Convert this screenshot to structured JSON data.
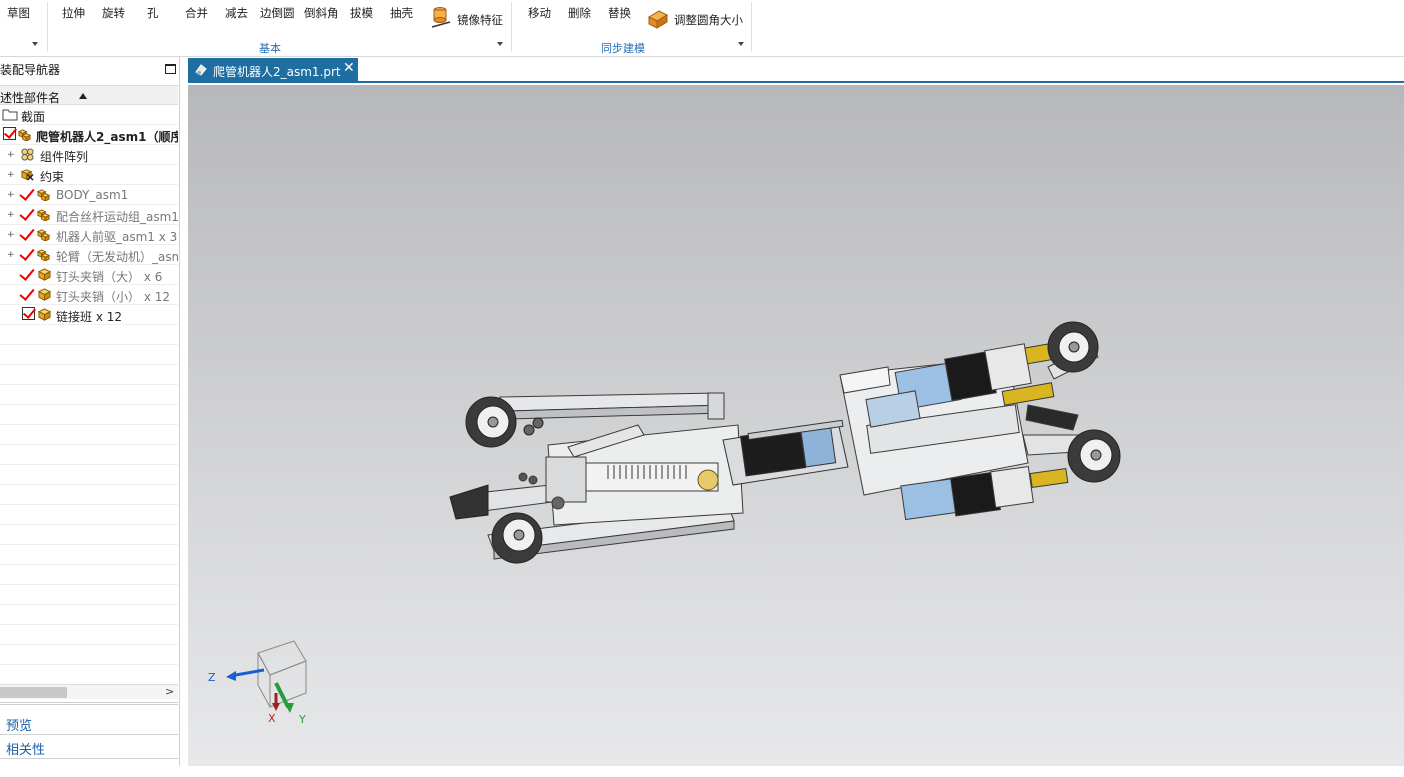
{
  "ribbon": {
    "sketch": "草图",
    "items": [
      "拉伸",
      "旋转",
      "孔",
      "合并",
      "减去",
      "边倒圆",
      "倒斜角",
      "拔模",
      "抽壳"
    ],
    "mirror_feature": "镜像特征",
    "group_basic": "基本",
    "sync_items": [
      "移动",
      "删除",
      "替换"
    ],
    "resize_blend": "调整圆角大小",
    "group_sync": "同步建模"
  },
  "navigator": {
    "title": "装配导航器",
    "column": "述性部件名",
    "rows": [
      "截面",
      "爬管机器人2_asm1（顺序",
      "组件阵列",
      "约束",
      "BODY_asm1",
      "配合丝杆运动组_asm1",
      "机器人前驱_asm1 x 3",
      "轮臂（无发动机）_asm",
      "钉头夹销（大） x 6",
      "钉头夹销（小） x 12",
      "链接班 x 12"
    ],
    "preview": "预览",
    "dependencies": "相关性"
  },
  "tab": {
    "title": "爬管机器人2_asm1.prt",
    "close": "✕"
  },
  "triad": {
    "x": "X",
    "y": "Y",
    "z": "Z"
  },
  "colors": {
    "accent": "#1e6ea1",
    "check": "#e00000",
    "section_link": "#1a5ea8"
  }
}
